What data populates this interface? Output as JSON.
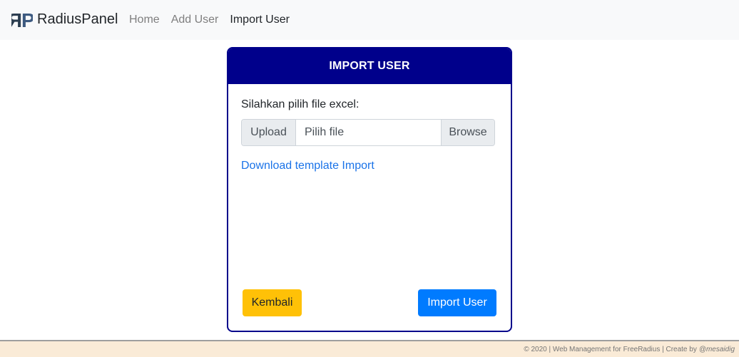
{
  "navbar": {
    "brand": {
      "logo_text": "RP",
      "name": "RadiusPanel"
    },
    "links": [
      {
        "label": "Home",
        "active": false
      },
      {
        "label": "Add User",
        "active": false
      },
      {
        "label": "Import User",
        "active": true
      }
    ]
  },
  "card": {
    "title": "IMPORT USER",
    "label": "Silahkan pilih file excel:",
    "file_input": {
      "prepend": "Upload",
      "placeholder": "Pilih file",
      "browse": "Browse"
    },
    "download_link": "Download template Import",
    "buttons": {
      "back": "Kembali",
      "import": "Import User"
    }
  },
  "footer": {
    "text": "© 2020 | Web Management for FreeRadius | Create by",
    "author": "@mesaidig"
  },
  "colors": {
    "card_header": "#00008b",
    "back_button": "#ffc107",
    "import_button": "#007bff",
    "link": "#1a73e8",
    "footer_bg": "#faebd7",
    "navbar_bg": "#f8f9fa"
  }
}
